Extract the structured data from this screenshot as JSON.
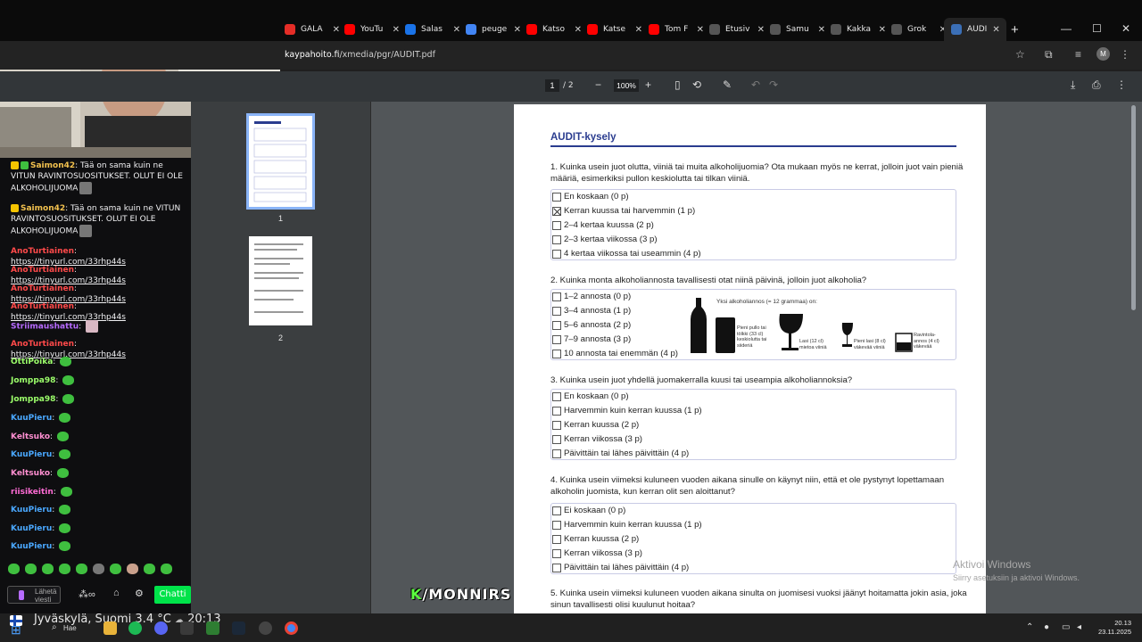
{
  "tabs": [
    {
      "label": "GALA",
      "color": "#e52d27",
      "active": false
    },
    {
      "label": "YouTu",
      "color": "#ff0000",
      "active": false
    },
    {
      "label": "Salas",
      "color": "#1a73e8",
      "active": false
    },
    {
      "label": "peuge",
      "color": "#4285f4",
      "active": false
    },
    {
      "label": "Katso",
      "color": "#ff0000",
      "active": false
    },
    {
      "label": "Katse",
      "color": "#ff0000",
      "active": false
    },
    {
      "label": "Tom F",
      "color": "#ff0000",
      "active": false
    },
    {
      "label": "Etusiv",
      "color": "#555555",
      "active": false
    },
    {
      "label": "Samu",
      "color": "#555555",
      "active": false
    },
    {
      "label": "Kakka",
      "color": "#555555",
      "active": false
    },
    {
      "label": "Grok",
      "color": "#555555",
      "active": false
    },
    {
      "label": "AUDI",
      "color": "#3b6fb6",
      "active": true
    }
  ],
  "address": {
    "host": "kaypahoito.fi",
    "path": "/xmedia/pgr/AUDIT.pdf"
  },
  "pdf_toolbar": {
    "page_current": "1",
    "page_total": "/ 2",
    "zoom": "100%"
  },
  "thumbnails": [
    {
      "label": "1"
    },
    {
      "label": "2"
    }
  ],
  "document": {
    "title": "AUDIT-kysely",
    "q1": {
      "text": "1. Kuinka usein juot olutta, viiniä tai muita alkoholijuomia? Ota mukaan myös ne kerrat, jolloin juot vain pieniä määriä, esimerkiksi pullon keskiolutta tai tilkan viiniä.",
      "options": [
        "En koskaan (0 p)",
        "Kerran kuussa tai harvemmin (1 p)",
        "2–4 kertaa kuussa (2 p)",
        "2–3 kertaa viikossa (3 p)",
        "4 kertaa viikossa tai useammin (4 p)"
      ],
      "checked_index": 1
    },
    "q2": {
      "text": "2. Kuinka monta alkoholiannosta tavallisesti otat niinä päivinä, jolloin juot alkoholia?",
      "options": [
        "1–2 annosta (0 p)",
        "3–4 annosta (1 p)",
        "5–6 annosta (2 p)",
        "7–9 annosta (3 p)",
        "10 annosta tai enemmän (4 p)"
      ],
      "illustration_heading": "Yksi alkoholiannos (= 12 grammaa) on:",
      "illustration_captions": [
        "Pieni pullo tai tölkki (33 cl) keskiolutta tai siideriä",
        "Lasi (12 cl) mietoa viiniä",
        "Pieni lasi (8 cl) väkevää viiniä",
        "Ravintola-annos (4 cl) väkevää"
      ]
    },
    "q3": {
      "text": "3. Kuinka usein juot yhdellä juomakerralla kuusi tai useampia alkoholiannoksia?",
      "options": [
        "En koskaan (0 p)",
        "Harvemmin kuin kerran kuussa (1 p)",
        "Kerran kuussa (2 p)",
        "Kerran viikossa (3 p)",
        "Päivittäin tai lähes päivittäin (4 p)"
      ]
    },
    "q4": {
      "text": "4. Kuinka usein viimeksi kuluneen vuoden aikana sinulle on käynyt niin, että et ole pystynyt lopettamaan alkoholin juomista, kun kerran olit sen aloittanut?",
      "options": [
        "Ei koskaan (0 p)",
        "Harvemmin kuin kerran kuussa (1 p)",
        "Kerran kuussa (2 p)",
        "Kerran viikossa (3 p)",
        "Päivittäin tai lähes päivittäin (4 p)"
      ]
    },
    "q5": {
      "text": "5. Kuinka usein viimeksi kuluneen vuoden aikana sinulta on juomisesi vuoksi jäänyt hoitamatta jokin asia, joka sinun tavallisesti olisi kuulunut hoitaa?"
    }
  },
  "watermark": {
    "line1": "Aktivoi Windows",
    "line2": "Siirry asetuksiin ja aktivoi Windows."
  },
  "chat": {
    "messages": [
      {
        "user": "Saimon42",
        "user_color": "#f2c14e",
        "text": "Tää on sama kuin ne VITUN RAVINTOSUOSITUKSET. OLUT EI OLE ALKOHOLIJUOMA",
        "badges": [
          "#f5c400",
          "#3fbf3f"
        ]
      },
      {
        "user": "Saimon42",
        "user_color": "#f2c14e",
        "text": "Tää on sama kuin ne VITUN RAVINTOSUOSITUKSET. OLUT EI OLE ALKOHOLIJUOMA",
        "badges": [
          "#f5c400"
        ]
      },
      {
        "user": "AnoTurtiainen",
        "user_color": "#ff4a4a",
        "text": "https://tinyurl.com/33rhp44s"
      },
      {
        "user": "AnoTurtiainen",
        "user_color": "#ff4a4a",
        "text": "https://tinyurl.com/33rhp44s"
      },
      {
        "user": "AnoTurtiainen",
        "user_color": "#ff4a4a",
        "text": "https://tinyurl.com/33rhp44s"
      },
      {
        "user": "AnoTurtiainen",
        "user_color": "#ff4a4a",
        "text": "https://tinyurl.com/33rhp44s"
      },
      {
        "user": "Striimaushattu",
        "user_color": "#b76bff",
        "text": ""
      },
      {
        "user": "AnoTurtiainen",
        "user_color": "#ff4a4a",
        "text": "https://tinyurl.com/33rhp44s"
      },
      {
        "user": "OttiPoika",
        "user_color": "#9cff6b",
        "text": ""
      },
      {
        "user": "Jomppa98",
        "user_color": "#9cff6b",
        "text": ""
      },
      {
        "user": "Jomppa98",
        "user_color": "#9cff6b",
        "text": ""
      },
      {
        "user": "KuuPieru",
        "user_color": "#4aa8ff",
        "text": ""
      },
      {
        "user": "Keltsuko",
        "user_color": "#ff8fd1",
        "text": ""
      },
      {
        "user": "KuuPieru",
        "user_color": "#4aa8ff",
        "text": ""
      },
      {
        "user": "Keltsuko",
        "user_color": "#ff8fd1",
        "text": ""
      },
      {
        "user": "riisikeitin",
        "user_color": "#ff6bd5",
        "text": ""
      },
      {
        "user": "KuuPieru",
        "user_color": "#4aa8ff",
        "text": ""
      },
      {
        "user": "KuuPieru",
        "user_color": "#4aa8ff",
        "text": ""
      },
      {
        "user": "KuuPieru",
        "user_color": "#4aa8ff",
        "text": ""
      }
    ],
    "send_placeholder": "Lähetä viesti",
    "chat_button": "Chatti"
  },
  "overlay": {
    "weather": "Jyväskylä, Suomi   3.4 °C",
    "time_overlay": "20:13",
    "logo_prefix": "K",
    "logo_text": "/MONNIRS"
  },
  "taskbar": {
    "search": "Hae",
    "time": "20.13",
    "date": "23.11.2025"
  }
}
